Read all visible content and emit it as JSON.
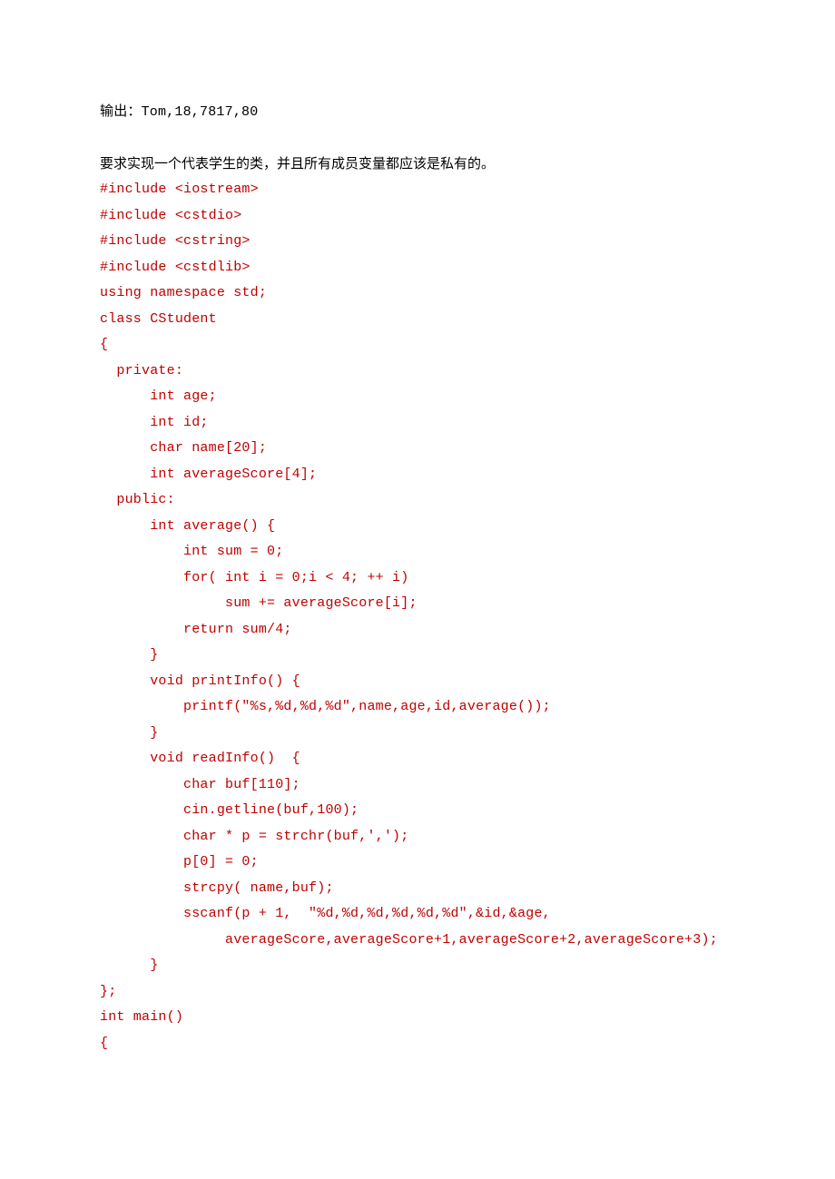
{
  "output_line": "输出：Tom,18,7817,80",
  "desc_line": "要求实现一个代表学生的类，并且所有成员变量都应该是私有的。",
  "code_lines": [
    "#include <iostream>",
    "#include <cstdio>",
    "#include <cstring>",
    "#include <cstdlib>",
    "using namespace std;",
    "class CStudent",
    "{",
    "  private:",
    "      int age;",
    "      int id;",
    "      char name[20];",
    "      int averageScore[4];",
    "  public:",
    "      int average() {",
    "          int sum = 0;",
    "          for( int i = 0;i < 4; ++ i)",
    "               sum += averageScore[i];",
    "          return sum/4;",
    "      }",
    "      void printInfo() {",
    "          printf(\"%s,%d,%d,%d\",name,age,id,average());",
    "      }",
    "      void readInfo()  {",
    "          char buf[110];",
    "          cin.getline(buf,100);",
    "          char * p = strchr(buf,',');",
    "          p[0] = 0;",
    "          strcpy( name,buf);",
    "          sscanf(p + 1,  \"%d,%d,%d,%d,%d,%d\",&id,&age,",
    "               averageScore,averageScore+1,averageScore+2,averageScore+3);",
    "      }",
    "};",
    "int main()",
    "{"
  ]
}
